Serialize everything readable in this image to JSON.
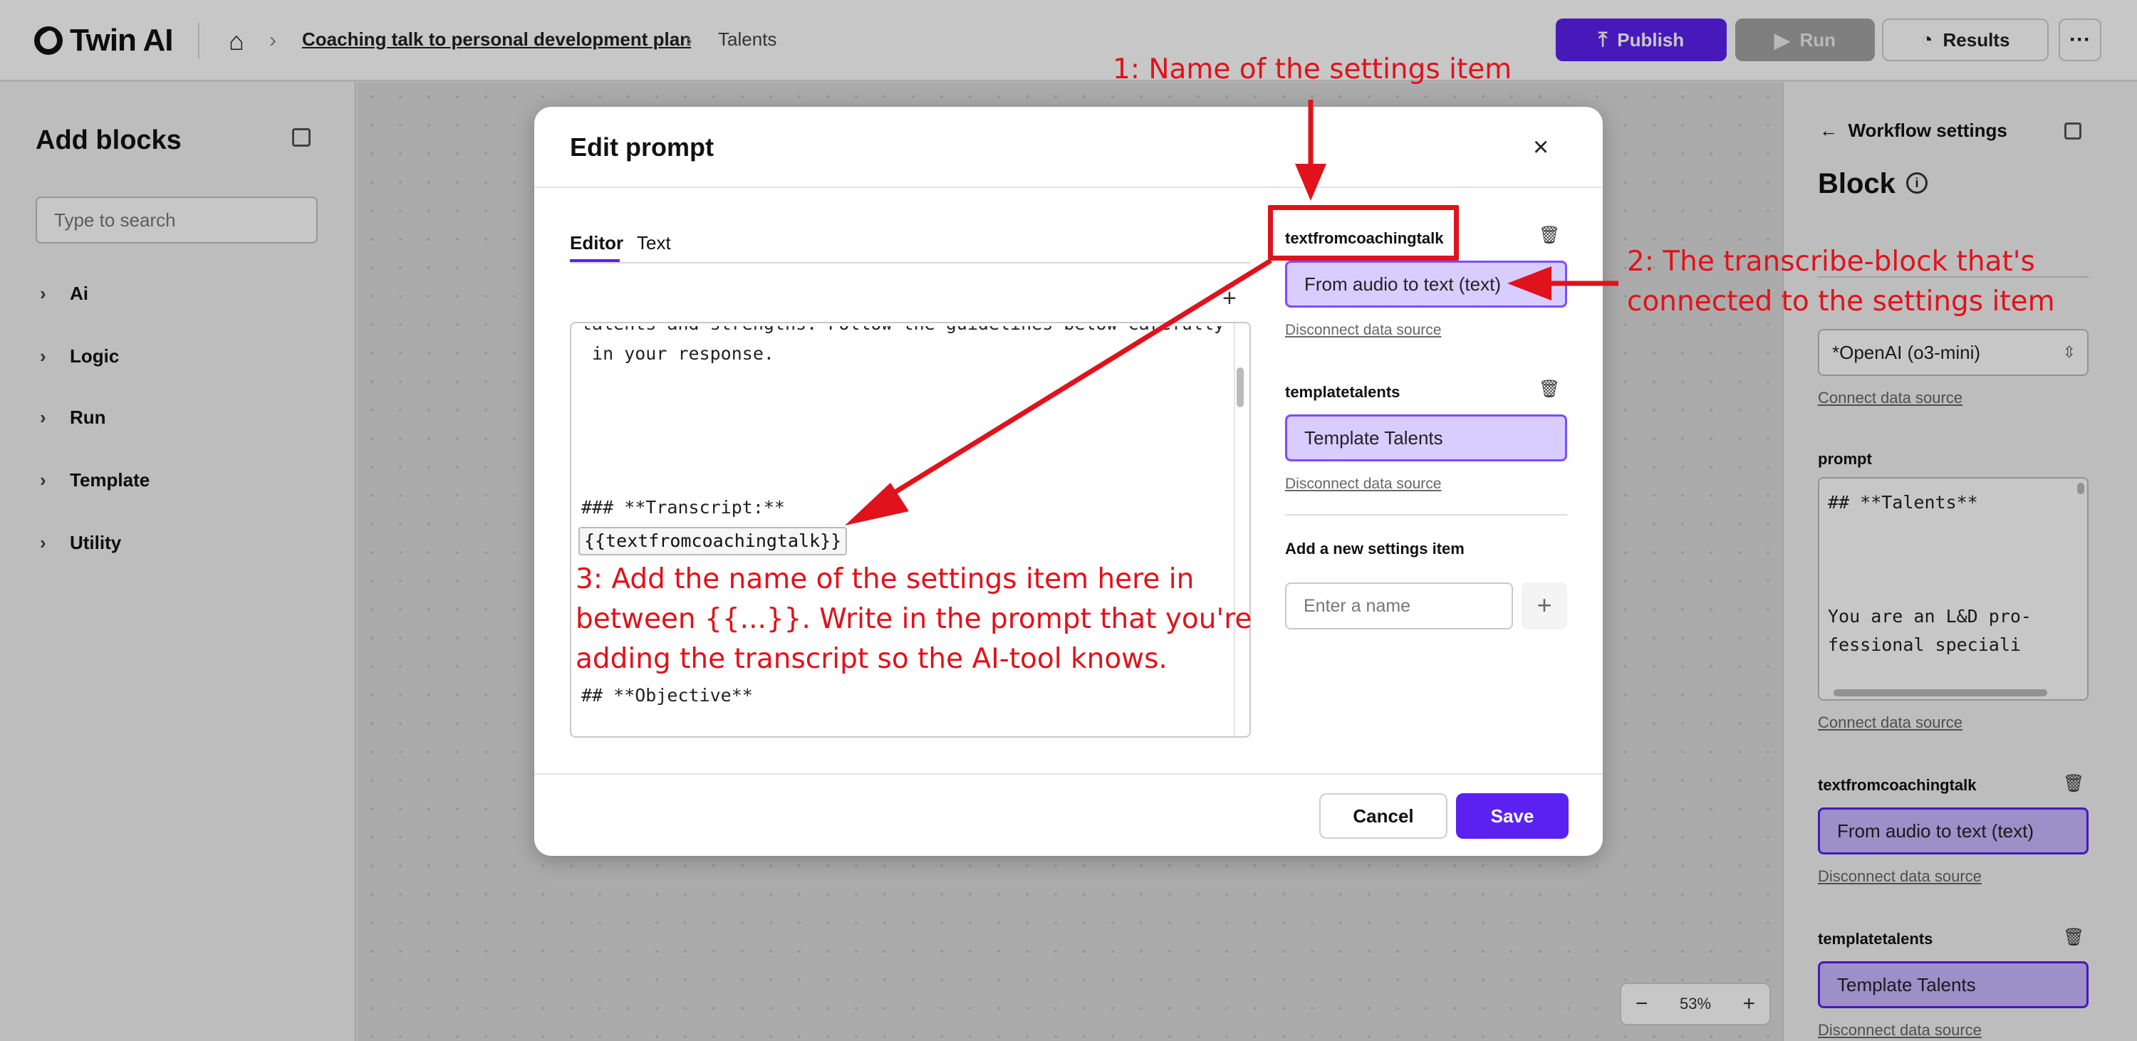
{
  "app": {
    "logo": "Twin AI",
    "breadcrumb": [
      "Coaching talk to personal development plan",
      "Talents"
    ],
    "buttons": {
      "publish": "Publish",
      "run": "Run",
      "results": "Results",
      "more": "···"
    }
  },
  "left_sidebar": {
    "title": "Add blocks",
    "search_placeholder": "Type to search",
    "categories": [
      "Ai",
      "Logic",
      "Run",
      "Template",
      "Utility"
    ]
  },
  "right_panel": {
    "back_label": "Workflow settings",
    "title": "Block",
    "model_select": "*OpenAI (o3-mini)",
    "connect_link": "Connect data source",
    "prompt_label": "prompt",
    "prompt_preview": "## **Talents**\n\n\n\nYou are an L&D pro-\nfessional speciali",
    "prompt_connect_link": "Connect data source",
    "items": [
      {
        "name": "textfromcoachingtalk",
        "value": "From audio to text (text)",
        "link": "Disconnect data source"
      },
      {
        "name": "templatetalents",
        "value": "Template Talents",
        "link": "Disconnect data source"
      }
    ]
  },
  "zoom": {
    "minus": "−",
    "level": "53%",
    "plus": "+"
  },
  "modal": {
    "title": "Edit prompt",
    "close": "×",
    "tabs": [
      "Editor",
      "Text"
    ],
    "editor_lines": [
      "talents and strengths. Follow the guidelines below carefully",
      " in your response.",
      "### **Transcript:**",
      "{{textfromcoachingtalk}}",
      "## **Objective**"
    ],
    "settings_items": [
      {
        "name": "textfromcoachingtalk",
        "value": "From audio to text (text)",
        "link": "Disconnect data source"
      },
      {
        "name": "templatetalents",
        "value": "Template Talents",
        "link": "Disconnect data source"
      }
    ],
    "add_label": "Add a new settings item",
    "add_placeholder": "Enter a name",
    "cancel": "Cancel",
    "save": "Save"
  },
  "annotations": {
    "a1": "1: Name of the settings item",
    "a2": "2: The transcribe-block that's\nconnected to the settings item",
    "a3": "3: Add the name of the settings item here in\nbetween {{...}}. Write in the prompt that you're\nadding the transcript so the AI-tool knows."
  },
  "colors": {
    "accent": "#5b21f0",
    "annotation": "#e0121b",
    "chip": "#d9ccff"
  }
}
